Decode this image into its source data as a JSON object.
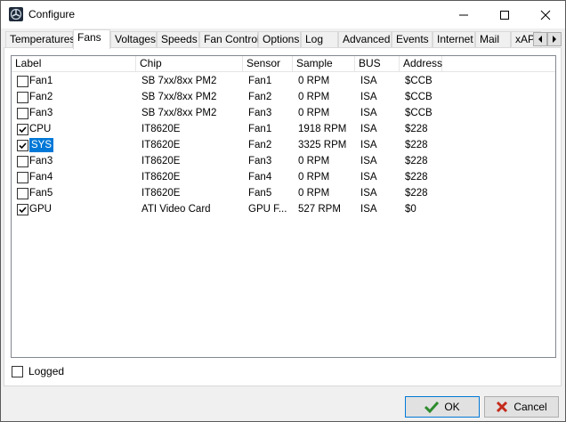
{
  "window": {
    "title": "Configure"
  },
  "tabs": [
    "Temperatures",
    "Fans",
    "Voltages",
    "Speeds",
    "Fan Control",
    "Options",
    "Log",
    "Advanced",
    "Events",
    "Internet",
    "Mail",
    "xAP"
  ],
  "active_tab": "Fans",
  "columns": [
    "Label",
    "Chip",
    "Sensor",
    "Sample",
    "BUS",
    "Address"
  ],
  "rows": [
    {
      "checked": false,
      "label": "Fan1",
      "chip": "SB 7xx/8xx PM2",
      "sensor": "Fan1",
      "sample": "0 RPM",
      "bus": "ISA",
      "address": "$CCB"
    },
    {
      "checked": false,
      "label": "Fan2",
      "chip": "SB 7xx/8xx PM2",
      "sensor": "Fan2",
      "sample": "0 RPM",
      "bus": "ISA",
      "address": "$CCB"
    },
    {
      "checked": false,
      "label": "Fan3",
      "chip": "SB 7xx/8xx PM2",
      "sensor": "Fan3",
      "sample": "0 RPM",
      "bus": "ISA",
      "address": "$CCB"
    },
    {
      "checked": true,
      "label": "CPU",
      "chip": "IT8620E",
      "sensor": "Fan1",
      "sample": "1918 RPM",
      "bus": "ISA",
      "address": "$228"
    },
    {
      "checked": true,
      "label": "SYS",
      "chip": "IT8620E",
      "sensor": "Fan2",
      "sample": "3325 RPM",
      "bus": "ISA",
      "address": "$228",
      "selected": true
    },
    {
      "checked": false,
      "label": "Fan3",
      "chip": "IT8620E",
      "sensor": "Fan3",
      "sample": "0 RPM",
      "bus": "ISA",
      "address": "$228"
    },
    {
      "checked": false,
      "label": "Fan4",
      "chip": "IT8620E",
      "sensor": "Fan4",
      "sample": "0 RPM",
      "bus": "ISA",
      "address": "$228"
    },
    {
      "checked": false,
      "label": "Fan5",
      "chip": "IT8620E",
      "sensor": "Fan5",
      "sample": "0 RPM",
      "bus": "ISA",
      "address": "$228"
    },
    {
      "checked": true,
      "label": "GPU",
      "chip": "ATI Video Card",
      "sensor": "GPU F...",
      "sample": "527 RPM",
      "bus": "ISA",
      "address": "$0"
    }
  ],
  "logged": {
    "label": "Logged",
    "checked": false
  },
  "buttons": {
    "ok": "OK",
    "cancel": "Cancel"
  },
  "colors": {
    "selection": "#0078d7",
    "ok_check": "#2e8b2e",
    "cancel_x": "#c42b1c"
  },
  "icons": [
    "app-icon",
    "minimize-icon",
    "maximize-icon",
    "close-icon",
    "tab-scroll-left-icon",
    "tab-scroll-right-icon",
    "checkmark-icon",
    "cancel-x-icon"
  ]
}
